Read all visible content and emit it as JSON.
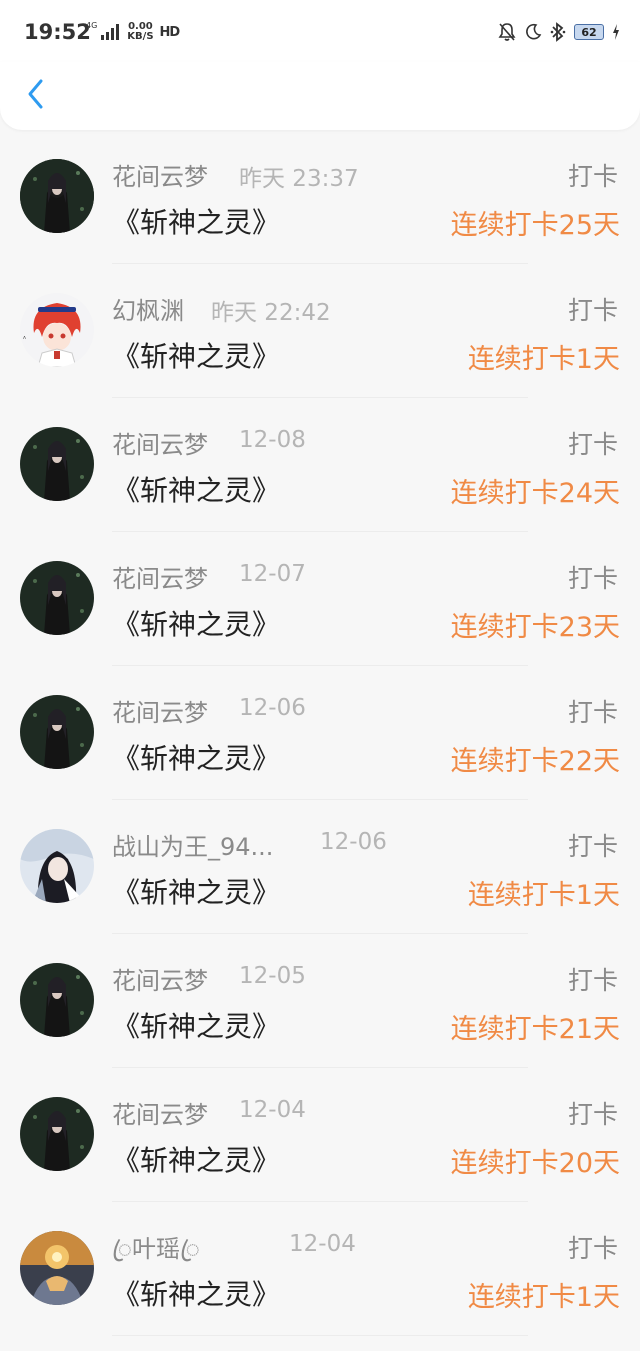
{
  "status_bar": {
    "time": "19:52",
    "network_type": "4G",
    "speed_value": "0.00",
    "speed_unit": "KB/S",
    "hd": "HD",
    "battery": "62"
  },
  "header": {
    "back_icon": "chevron-left-icon",
    "accent_color": "#2e9bf0"
  },
  "colors": {
    "streak": "#f08a45",
    "name": "#8a8a8a",
    "time": "#b5b5b5",
    "title": "#222222"
  },
  "items": [
    {
      "avatar": "dark-anime-avatar",
      "name": "花间云梦",
      "time": "昨天 23:37",
      "action": "打卡",
      "book": "《斩神之灵》",
      "streak": "连续打卡25天"
    },
    {
      "avatar": "red-hair-anime-avatar",
      "name": "幻枫渊",
      "time": "昨天 22:42",
      "action": "打卡",
      "book": "《斩神之灵》",
      "streak": "连续打卡1天"
    },
    {
      "avatar": "dark-anime-avatar",
      "name": "花间云梦",
      "time": "12-08",
      "action": "打卡",
      "book": "《斩神之灵》",
      "streak": "连续打卡24天"
    },
    {
      "avatar": "dark-anime-avatar",
      "name": "花间云梦",
      "time": "12-07",
      "action": "打卡",
      "book": "《斩神之灵》",
      "streak": "连续打卡23天"
    },
    {
      "avatar": "dark-anime-avatar",
      "name": "花间云梦",
      "time": "12-06",
      "action": "打卡",
      "book": "《斩神之灵》",
      "streak": "连续打卡22天"
    },
    {
      "avatar": "ink-style-anime-avatar",
      "name": "战山为王_94...",
      "time": "12-06",
      "action": "打卡",
      "book": "《斩神之灵》",
      "streak": "连续打卡1天"
    },
    {
      "avatar": "dark-anime-avatar",
      "name": "花间云梦",
      "time": "12-05",
      "action": "打卡",
      "book": "《斩神之灵》",
      "streak": "连续打卡21天"
    },
    {
      "avatar": "dark-anime-avatar",
      "name": "花间云梦",
      "time": "12-04",
      "action": "打卡",
      "book": "《斩神之灵》",
      "streak": "连续打卡20天"
    },
    {
      "avatar": "warm-light-avatar",
      "name": "ꦿ叶瑶ꦿ",
      "time": "12-04",
      "action": "打卡",
      "book": "《斩神之灵》",
      "streak": "连续打卡1天"
    }
  ]
}
